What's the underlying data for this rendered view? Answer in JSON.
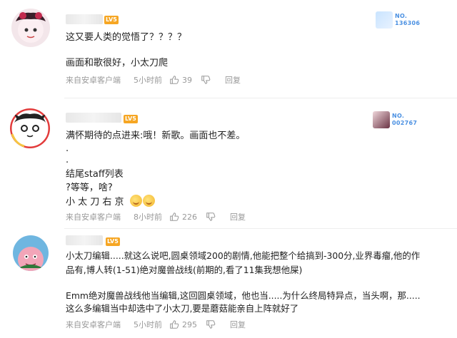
{
  "comments": [
    {
      "level_badge": "LV5",
      "medal": {
        "text": "NO.",
        "number": "136306"
      },
      "lines": [
        "这又要人类的觉悟了？？？？",
        "画面和歌很好，小太刀爬"
      ],
      "source": "来自安卓客户端",
      "time": "5小时前",
      "likes": "39",
      "reply": "回复"
    },
    {
      "level_badge": "LV5",
      "medal": {
        "text": "NO.",
        "number": "002767"
      },
      "lines": [
        "满怀期待的点进来:哦！新歌。画面也不差。",
        ".",
        ".",
        "结尾staff列表",
        "?等等，啥?",
        "小 太 刀 右 京"
      ],
      "source": "来自安卓客户端",
      "time": "8小时前",
      "likes": "226",
      "reply": "回复"
    },
    {
      "level_badge": "LV5",
      "lines": [
        "小太刀编辑.....就这么说吧,圆桌领域200的剧情,他能把整个给搞到-300分,业界毒瘤,他的作",
        "品有,博人转(1-51)绝对魔兽战线(前期的,看了11集我想他屎)",
        "Emm绝对魔兽战线他当编辑,这回圆桌领域，他也当.....为什么终局特异点，当头啊，那.....",
        "这么多编辑当中却选中了小太刀,要是蘑菇能亲自上阵就好了"
      ],
      "source": "来自安卓客户端",
      "time": "5小时前",
      "likes": "295",
      "reply": "回复"
    }
  ],
  "colors": {
    "level_badge": "#f6a623",
    "medal_text": "#4a90e2",
    "meta_text": "#999999"
  }
}
